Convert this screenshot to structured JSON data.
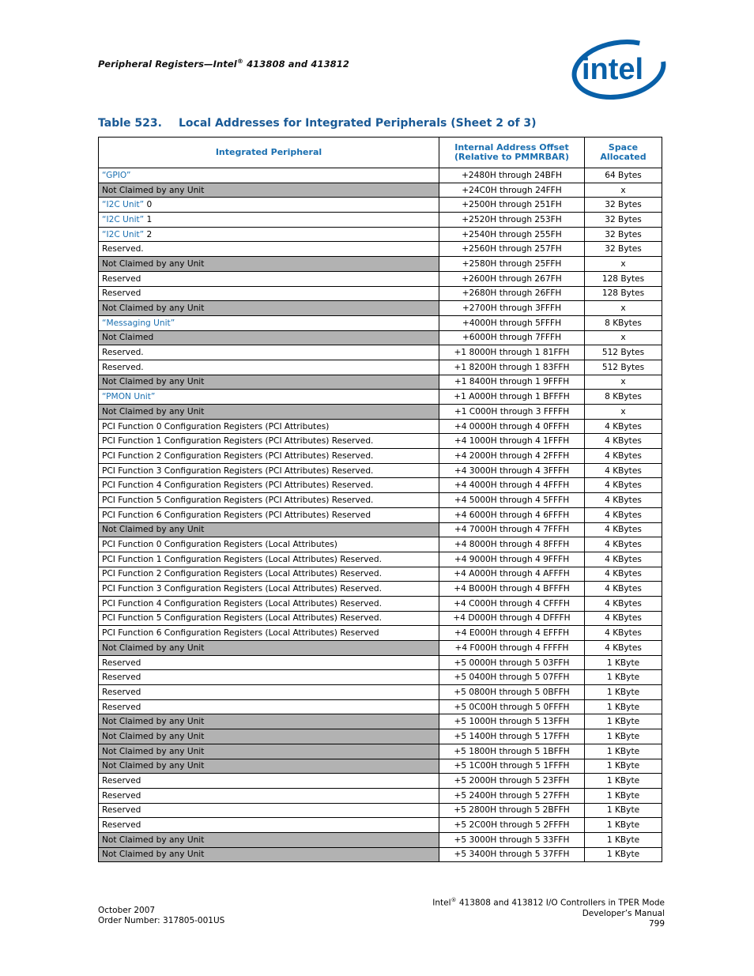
{
  "header": {
    "running_title_prefix": "Peripheral Registers—Intel",
    "running_title_reg": "®",
    "running_title_suffix": " 413808 and 413812",
    "logo_text": "intel",
    "logo_color": "#0860a8"
  },
  "table": {
    "number": "Table 523.",
    "title": "Local Addresses for Integrated Peripherals (Sheet 2 of 3)",
    "columns": [
      "Integrated Peripheral",
      "Internal Address Offset (Relative to PMMRBAR)",
      "Space Allocated"
    ],
    "shade_color": "#b2b2b2",
    "link_color": "#1a6fb0",
    "rows": [
      {
        "peripheral": "“GPIO”",
        "suffix": "",
        "link": true,
        "shaded": false,
        "offset": "+2480H through 24BFH",
        "space": "64 Bytes"
      },
      {
        "peripheral": "Not Claimed by any Unit",
        "suffix": "",
        "link": false,
        "shaded": true,
        "offset": "+24C0H through 24FFH",
        "space": "x"
      },
      {
        "peripheral": "“I2C Unit”",
        "suffix": " 0",
        "link": true,
        "shaded": false,
        "offset": "+2500H through 251FH",
        "space": "32 Bytes"
      },
      {
        "peripheral": "“I2C Unit”",
        "suffix": " 1",
        "link": true,
        "shaded": false,
        "offset": "+2520H through 253FH",
        "space": "32 Bytes"
      },
      {
        "peripheral": "“I2C Unit”",
        "suffix": " 2",
        "link": true,
        "shaded": false,
        "offset": "+2540H through 255FH",
        "space": "32 Bytes"
      },
      {
        "peripheral": "Reserved.",
        "suffix": "",
        "link": false,
        "shaded": false,
        "offset": "+2560H through 257FH",
        "space": "32 Bytes"
      },
      {
        "peripheral": "Not Claimed by any Unit",
        "suffix": "",
        "link": false,
        "shaded": true,
        "offset": "+2580H through 25FFH",
        "space": "x"
      },
      {
        "peripheral": "Reserved",
        "suffix": "",
        "link": false,
        "shaded": false,
        "offset": "+2600H through 267FH",
        "space": "128 Bytes"
      },
      {
        "peripheral": "Reserved",
        "suffix": "",
        "link": false,
        "shaded": false,
        "offset": "+2680H through 26FFH",
        "space": "128 Bytes"
      },
      {
        "peripheral": "Not Claimed by any Unit",
        "suffix": "",
        "link": false,
        "shaded": true,
        "offset": "+2700H through 3FFFH",
        "space": "x"
      },
      {
        "peripheral": "“Messaging Unit”",
        "suffix": "",
        "link": true,
        "shaded": false,
        "offset": "+4000H through 5FFFH",
        "space": "8 KBytes"
      },
      {
        "peripheral": "Not Claimed",
        "suffix": "",
        "link": false,
        "shaded": true,
        "offset": "+6000H through 7FFFH",
        "space": "x"
      },
      {
        "peripheral": "Reserved.",
        "suffix": "",
        "link": false,
        "shaded": false,
        "offset": "+1 8000H through 1 81FFH",
        "space": "512 Bytes"
      },
      {
        "peripheral": "Reserved.",
        "suffix": "",
        "link": false,
        "shaded": false,
        "offset": "+1 8200H through 1 83FFH",
        "space": "512 Bytes"
      },
      {
        "peripheral": "Not Claimed by any Unit",
        "suffix": "",
        "link": false,
        "shaded": true,
        "offset": "+1 8400H through 1 9FFFH",
        "space": "x"
      },
      {
        "peripheral": "“PMON Unit”",
        "suffix": "",
        "link": true,
        "shaded": false,
        "offset": "+1 A000H through 1 BFFFH",
        "space": "8 KBytes"
      },
      {
        "peripheral": "Not Claimed by any Unit",
        "suffix": "",
        "link": false,
        "shaded": true,
        "offset": "+1 C000H through 3 FFFFH",
        "space": "x"
      },
      {
        "peripheral": "PCI Function 0 Configuration Registers (PCI Attributes)",
        "suffix": "",
        "link": false,
        "shaded": false,
        "offset": "+4 0000H through 4 0FFFH",
        "space": "4 KBytes"
      },
      {
        "peripheral": "PCI Function 1 Configuration Registers (PCI Attributes) Reserved.",
        "suffix": "",
        "link": false,
        "shaded": false,
        "offset": "+4 1000H through 4 1FFFH",
        "space": "4 KBytes"
      },
      {
        "peripheral": "PCI Function 2 Configuration Registers (PCI Attributes) Reserved.",
        "suffix": "",
        "link": false,
        "shaded": false,
        "offset": "+4 2000H through 4 2FFFH",
        "space": "4 KBytes"
      },
      {
        "peripheral": "PCI Function 3 Configuration Registers (PCI Attributes) Reserved.",
        "suffix": "",
        "link": false,
        "shaded": false,
        "offset": "+4 3000H through 4 3FFFH",
        "space": "4 KBytes"
      },
      {
        "peripheral": "PCI Function 4 Configuration Registers (PCI Attributes) Reserved.",
        "suffix": "",
        "link": false,
        "shaded": false,
        "offset": "+4 4000H through 4 4FFFH",
        "space": "4 KBytes"
      },
      {
        "peripheral": "PCI Function 5 Configuration Registers (PCI Attributes) Reserved.",
        "suffix": "",
        "link": false,
        "shaded": false,
        "offset": "+4 5000H through 4 5FFFH",
        "space": "4 KBytes"
      },
      {
        "peripheral": "PCI Function 6 Configuration Registers (PCI Attributes) Reserved",
        "suffix": "",
        "link": false,
        "shaded": false,
        "offset": "+4 6000H through 4 6FFFH",
        "space": "4 KBytes"
      },
      {
        "peripheral": "Not Claimed by any Unit",
        "suffix": "",
        "link": false,
        "shaded": true,
        "offset": "+4 7000H through 4 7FFFH",
        "space": "4 KBytes"
      },
      {
        "peripheral": "PCI Function 0 Configuration Registers (Local Attributes)",
        "suffix": "",
        "link": false,
        "shaded": false,
        "offset": "+4 8000H through 4 8FFFH",
        "space": "4 KBytes"
      },
      {
        "peripheral": "PCI Function 1 Configuration Registers (Local Attributes) Reserved.",
        "suffix": "",
        "link": false,
        "shaded": false,
        "offset": "+4 9000H through 4 9FFFH",
        "space": "4 KBytes"
      },
      {
        "peripheral": "PCI Function 2 Configuration Registers (Local Attributes) Reserved.",
        "suffix": "",
        "link": false,
        "shaded": false,
        "offset": "+4 A000H through 4 AFFFH",
        "space": "4 KBytes"
      },
      {
        "peripheral": "PCI Function 3 Configuration Registers (Local Attributes) Reserved.",
        "suffix": "",
        "link": false,
        "shaded": false,
        "offset": "+4 B000H through 4 BFFFH",
        "space": "4 KBytes"
      },
      {
        "peripheral": "PCI Function 4 Configuration Registers (Local Attributes) Reserved.",
        "suffix": "",
        "link": false,
        "shaded": false,
        "offset": "+4 C000H through 4 CFFFH",
        "space": "4 KBytes"
      },
      {
        "peripheral": "PCI Function 5 Configuration Registers (Local Attributes) Reserved.",
        "suffix": "",
        "link": false,
        "shaded": false,
        "offset": "+4 D000H through 4 DFFFH",
        "space": "4 KBytes"
      },
      {
        "peripheral": "PCI Function 6 Configuration Registers (Local Attributes) Reserved",
        "suffix": "",
        "link": false,
        "shaded": false,
        "offset": "+4 E000H through 4 EFFFH",
        "space": "4 KBytes"
      },
      {
        "peripheral": "Not Claimed by any Unit",
        "suffix": "",
        "link": false,
        "shaded": true,
        "offset": "+4 F000H through 4 FFFFH",
        "space": "4 KBytes"
      },
      {
        "peripheral": "Reserved",
        "suffix": "",
        "link": false,
        "shaded": false,
        "offset": "+5 0000H through 5 03FFH",
        "space": "1 KByte"
      },
      {
        "peripheral": "Reserved",
        "suffix": "",
        "link": false,
        "shaded": false,
        "offset": "+5 0400H through 5 07FFH",
        "space": "1 KByte"
      },
      {
        "peripheral": "Reserved",
        "suffix": "",
        "link": false,
        "shaded": false,
        "offset": "+5 0800H through 5 0BFFH",
        "space": "1 KByte"
      },
      {
        "peripheral": "Reserved",
        "suffix": "",
        "link": false,
        "shaded": false,
        "offset": "+5 0C00H through 5 0FFFH",
        "space": "1 KByte"
      },
      {
        "peripheral": "Not Claimed by any Unit",
        "suffix": "",
        "link": false,
        "shaded": true,
        "offset": "+5 1000H through 5 13FFH",
        "space": "1 KByte"
      },
      {
        "peripheral": "Not Claimed by any Unit",
        "suffix": "",
        "link": false,
        "shaded": true,
        "offset": "+5 1400H through 5 17FFH",
        "space": "1 KByte"
      },
      {
        "peripheral": "Not Claimed by any Unit",
        "suffix": "",
        "link": false,
        "shaded": true,
        "offset": "+5 1800H through 5 1BFFH",
        "space": "1 KByte"
      },
      {
        "peripheral": "Not Claimed by any Unit",
        "suffix": "",
        "link": false,
        "shaded": true,
        "offset": "+5 1C00H through 5 1FFFH",
        "space": "1 KByte"
      },
      {
        "peripheral": "Reserved",
        "suffix": "",
        "link": false,
        "shaded": false,
        "offset": "+5 2000H through 5 23FFH",
        "space": "1 KByte"
      },
      {
        "peripheral": "Reserved",
        "suffix": "",
        "link": false,
        "shaded": false,
        "offset": "+5 2400H through 5 27FFH",
        "space": "1 KByte"
      },
      {
        "peripheral": "Reserved",
        "suffix": "",
        "link": false,
        "shaded": false,
        "offset": "+5 2800H through 5 2BFFH",
        "space": "1 KByte"
      },
      {
        "peripheral": "Reserved",
        "suffix": "",
        "link": false,
        "shaded": false,
        "offset": "+5 2C00H through 5 2FFFH",
        "space": "1 KByte"
      },
      {
        "peripheral": "Not Claimed by any Unit",
        "suffix": "",
        "link": false,
        "shaded": true,
        "offset": "+5 3000H through 5 33FFH",
        "space": "1 KByte"
      },
      {
        "peripheral": "Not Claimed by any Unit",
        "suffix": "",
        "link": false,
        "shaded": true,
        "offset": "+5 3400H through 5 37FFH",
        "space": "1 KByte"
      }
    ]
  },
  "footer": {
    "date": "October 2007",
    "order_number": "Order Number: 317805-001US",
    "doc_title_prefix": "Intel",
    "doc_title_reg": "®",
    "doc_title_suffix": " 413808 and 413812 I/O Controllers in TPER Mode",
    "doc_subtitle": "Developer’s Manual",
    "page_number": "799"
  }
}
